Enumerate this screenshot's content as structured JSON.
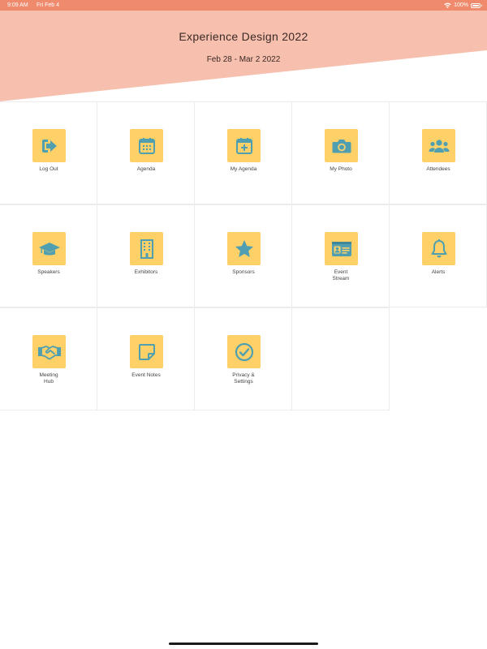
{
  "status_bar": {
    "time": "9:09 AM",
    "date": "Fri Feb 4",
    "battery": "100%"
  },
  "header": {
    "title": "Experience Design 2022",
    "dates": "Feb 28 - Mar 2 2022"
  },
  "colors": {
    "status_bar_bg": "#f08a6c",
    "header_bg": "#f7bfae",
    "tile_icon_bg": "#fdd168",
    "icon_fg": "#4f9fb1"
  },
  "tiles": [
    {
      "label": "Log Out",
      "icon": "logout-icon"
    },
    {
      "label": "Agenda",
      "icon": "calendar-icon"
    },
    {
      "label": "My Agenda",
      "icon": "calendar-plus-icon"
    },
    {
      "label": "My Photo",
      "icon": "camera-icon"
    },
    {
      "label": "Attendees",
      "icon": "users-icon"
    },
    {
      "label": "Speakers",
      "icon": "graduation-cap-icon"
    },
    {
      "label": "Exhibitors",
      "icon": "building-icon"
    },
    {
      "label": "Sponsors",
      "icon": "star-icon"
    },
    {
      "label": "Event\nStream",
      "icon": "id-card-icon"
    },
    {
      "label": "Alerts",
      "icon": "bell-icon"
    },
    {
      "label": "Meeting\nHub",
      "icon": "handshake-icon"
    },
    {
      "label": "Event Notes",
      "icon": "sticky-note-icon"
    },
    {
      "label": "Privacy &\nSettings",
      "icon": "check-circle-icon"
    }
  ]
}
